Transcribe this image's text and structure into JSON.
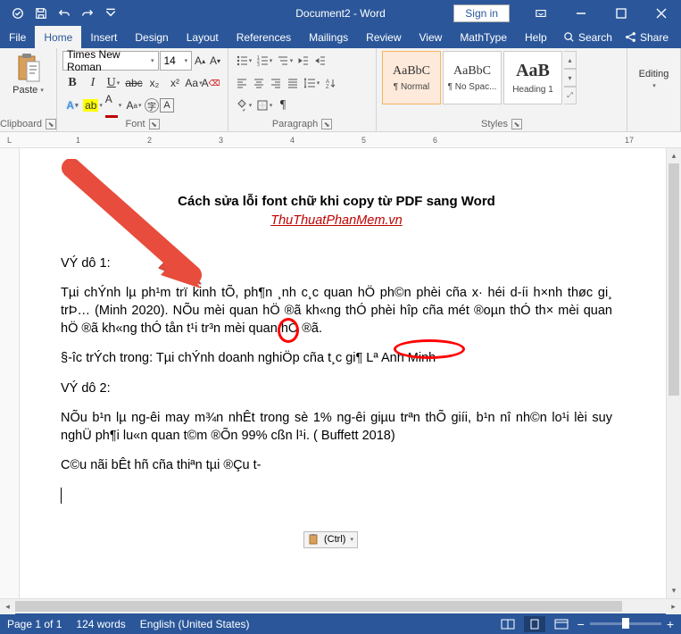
{
  "titlebar": {
    "title": "Document2 - Word",
    "signin": "Sign in"
  },
  "tabs": {
    "file": "File",
    "home": "Home",
    "insert": "Insert",
    "design": "Design",
    "layout": "Layout",
    "references": "References",
    "mailings": "Mailings",
    "review": "Review",
    "view": "View",
    "mathtype": "MathType",
    "help": "Help",
    "search": "Search",
    "share": "Share"
  },
  "ribbon": {
    "clipboard": {
      "paste": "Paste",
      "label": "Clipboard"
    },
    "font": {
      "name": "Times New Roman",
      "size": "14",
      "label": "Font",
      "bold": "B",
      "italic": "I",
      "underline": "U",
      "strike": "abc",
      "sub": "x₂",
      "sup": "x²",
      "effects": "A",
      "highlight": "ab",
      "fontcolor": "A",
      "clear": "A",
      "incr": "A",
      "decr": "A",
      "case": "Aa"
    },
    "paragraph": {
      "label": "Paragraph"
    },
    "styles": {
      "label": "Styles",
      "items": [
        {
          "preview": "AaBbC",
          "label": "¶ Normal"
        },
        {
          "preview": "AaBbC",
          "label": "¶ No Spac..."
        },
        {
          "preview": "AaB",
          "label": "Heading 1"
        }
      ]
    },
    "editing": {
      "label": "Editing"
    }
  },
  "document": {
    "title": "Cách sửa lỗi font chữ khi copy từ PDF sang Word",
    "subtitle": "ThuThuatPhanMem.vn",
    "p1": "VÝ dô 1:",
    "p2": "Tµi chÝnh lµ ph¹m trï kinh tÕ, ph¶n ¸nh c¸c quan hÖ ph©n phèi cña x· héi d-íi h×nh thøc gi¸ trÞ… (Minh 2020). NÕu mèi quan hÖ ®ã kh«ng thÓ phèi hîp cña mét ®oµn thÓ th× mèi quan hÖ ®ã kh«ng thÓ tån t¹i tr³n mèi quan hÖ ®ã.",
    "p3": "§-îc trÝch trong: Tµi chÝnh doanh nghiÖp cña t¸c gi¶ Lª Anh Minh",
    "p4": "VÝ dô 2:",
    "p5": "NÕu b¹n lµ ng-êi may m¾n nhÊt trong sè 1% ng-êi giµu trªn thÕ giíi, b¹n nî nh©n lo¹i lèi suy nghÜ ph¶i lu«n quan t©m ®Õn 99% cßn l¹i. ( Buffett 2018)",
    "p6": "C©u nãi bÊt hñ cña thiªn tµi ®Çu t-",
    "ctrl_badge": "(Ctrl)"
  },
  "statusbar": {
    "page": "Page 1 of 1",
    "words": "124 words",
    "lang": "English (United States)",
    "zoom_minus": "−",
    "zoom_plus": "+",
    "zoom_pct": "100%"
  }
}
